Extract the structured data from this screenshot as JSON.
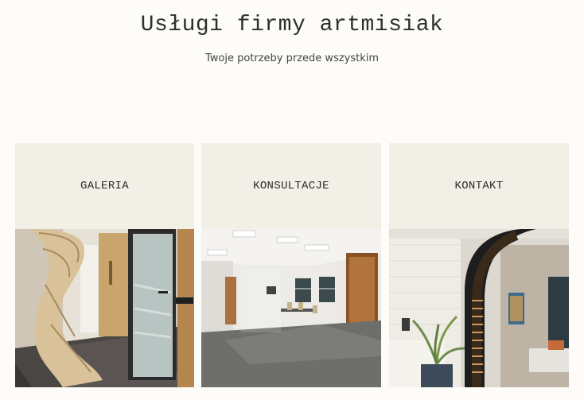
{
  "header": {
    "title": "Usługi firmy artmisiak",
    "subtitle": "Twoje potrzeby przede wszystkim"
  },
  "cards": [
    {
      "label": "GALERIA",
      "image": "interior-photo-wooden-sculpture-and-glass-door"
    },
    {
      "label": "KONSULTACJE",
      "image": "interior-photo-office-conference-room"
    },
    {
      "label": "KONTAKT",
      "image": "interior-photo-arched-wooden-partition-with-plant"
    }
  ],
  "colors": {
    "background": "#fdfcf9",
    "card_header": "#f1efe6",
    "text": "#2f2f2f"
  }
}
